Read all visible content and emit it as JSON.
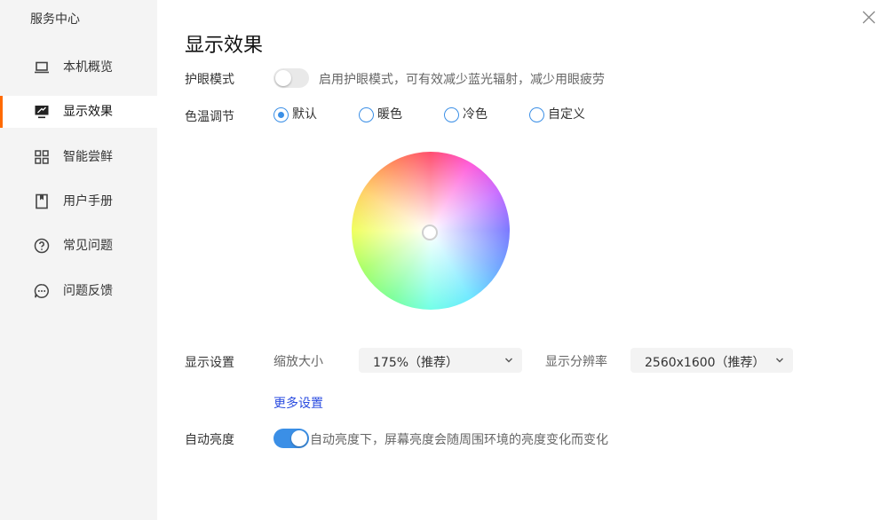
{
  "app": {
    "title": "服务中心"
  },
  "sidebar": {
    "items": [
      {
        "label": "本机概览",
        "icon": "laptop-icon"
      },
      {
        "label": "显示效果",
        "icon": "monitor-icon",
        "active": true
      },
      {
        "label": "智能尝鲜",
        "icon": "grid-icon"
      },
      {
        "label": "用户手册",
        "icon": "book-icon"
      },
      {
        "label": "常见问题",
        "icon": "question-icon"
      },
      {
        "label": "问题反馈",
        "icon": "chat-icon"
      }
    ]
  },
  "main": {
    "title": "显示效果",
    "eye_care": {
      "label": "护眼模式",
      "enabled": false,
      "description": "启用护眼模式，可有效减少蓝光辐射，减少用眼疲劳"
    },
    "color_temp": {
      "label": "色温调节",
      "options": [
        "默认",
        "暖色",
        "冷色",
        "自定义"
      ],
      "selected": "默认"
    },
    "display": {
      "label": "显示设置",
      "scale_label": "缩放大小",
      "scale_value": "175%（推荐）",
      "resolution_label": "显示分辨率",
      "resolution_value": "2560x1600（推荐）",
      "more_link": "更多设置"
    },
    "auto_brightness": {
      "label": "自动亮度",
      "enabled": true,
      "description": "自动亮度下，屏幕亮度会随周围环境的亮度变化而变化"
    }
  },
  "colors": {
    "accent": "#3b8fe6",
    "active_indicator": "#ff6a00",
    "link": "#2b4ce0"
  }
}
